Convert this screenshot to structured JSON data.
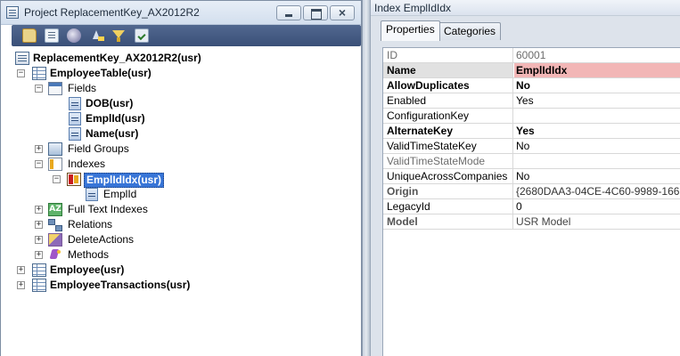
{
  "left_window": {
    "title": "Project ReplacementKey_AX2012R2",
    "controls": {
      "minimize": "minimize",
      "maximize": "maximize",
      "close": "×"
    },
    "toolbar_icons": [
      "open-icon",
      "properties-icon",
      "compile-icon",
      "sort-icon",
      "filter-icon",
      "check-icon"
    ]
  },
  "tree": {
    "nodes": [
      {
        "label": "ReplacementKey_AX2012R2(usr)",
        "icon": "project-icon",
        "bold": true
      },
      {
        "label": "EmployeeTable(usr)",
        "icon": "table-icon",
        "expander": "−",
        "bold": true
      },
      {
        "label": "Fields",
        "icon": "fields-icon",
        "expander": "−",
        "bold": false
      },
      {
        "label": "DOB(usr)",
        "icon": "field-icon",
        "bold": true
      },
      {
        "label": "EmplId(usr)",
        "icon": "field-icon",
        "bold": true
      },
      {
        "label": "Name(usr)",
        "icon": "field-icon",
        "bold": true
      },
      {
        "label": "Field Groups",
        "icon": "field-groups-icon",
        "expander": "+",
        "bold": false
      },
      {
        "label": "Indexes",
        "icon": "indexes-icon",
        "expander": "−",
        "bold": false
      },
      {
        "label": "EmplIdIdx(usr)",
        "icon": "index-icon",
        "expander": "−",
        "bold": true,
        "selected": true
      },
      {
        "label": "EmplId",
        "icon": "index-field-icon",
        "bold": false
      },
      {
        "label": "Full Text Indexes",
        "icon": "full-text-indexes-icon",
        "expander": "+",
        "bold": false
      },
      {
        "label": "Relations",
        "icon": "relations-icon",
        "expander": "+",
        "bold": false
      },
      {
        "label": "DeleteActions",
        "icon": "delete-actions-icon",
        "expander": "+",
        "bold": false
      },
      {
        "label": "Methods",
        "icon": "methods-icon",
        "expander": "+",
        "bold": false
      },
      {
        "label": "Employee(usr)",
        "icon": "table-icon",
        "expander": "+",
        "bold": true
      },
      {
        "label": "EmployeeTransactions(usr)",
        "icon": "table-icon",
        "expander": "+",
        "bold": true
      }
    ],
    "full_text_icon_text": "AZ"
  },
  "right_window": {
    "title": "Index EmplIdIdx",
    "tabs": [
      {
        "label": "Properties",
        "active": true
      },
      {
        "label": "Categories",
        "active": false
      }
    ]
  },
  "properties": [
    {
      "name": "ID",
      "value": "60001",
      "style": "gray"
    },
    {
      "name": "Name",
      "value": "EmplIdIdx",
      "style": "bold",
      "selected": true
    },
    {
      "name": "AllowDuplicates",
      "value": "No",
      "style": "bold"
    },
    {
      "name": "Enabled",
      "value": "Yes",
      "style": "normal"
    },
    {
      "name": "ConfigurationKey",
      "value": "",
      "style": "normal"
    },
    {
      "name": "AlternateKey",
      "value": "Yes",
      "style": "bold"
    },
    {
      "name": "ValidTimeStateKey",
      "value": "No",
      "style": "normal"
    },
    {
      "name": "ValidTimeStateMode",
      "value": "",
      "style": "gray"
    },
    {
      "name": "UniqueAcrossCompanies",
      "value": "No",
      "style": "normal"
    },
    {
      "name": "Origin",
      "value": "{2680DAA3-04CE-4C60-9989-166",
      "style": "gray-bold"
    },
    {
      "name": "LegacyId",
      "value": "0",
      "style": "normal"
    },
    {
      "name": "Model",
      "value": "USR Model",
      "style": "gray-bold"
    }
  ],
  "colors": {
    "selection": "#3875d7",
    "selected_value": "#f2b6b6",
    "toolbar": "#3a5078"
  }
}
